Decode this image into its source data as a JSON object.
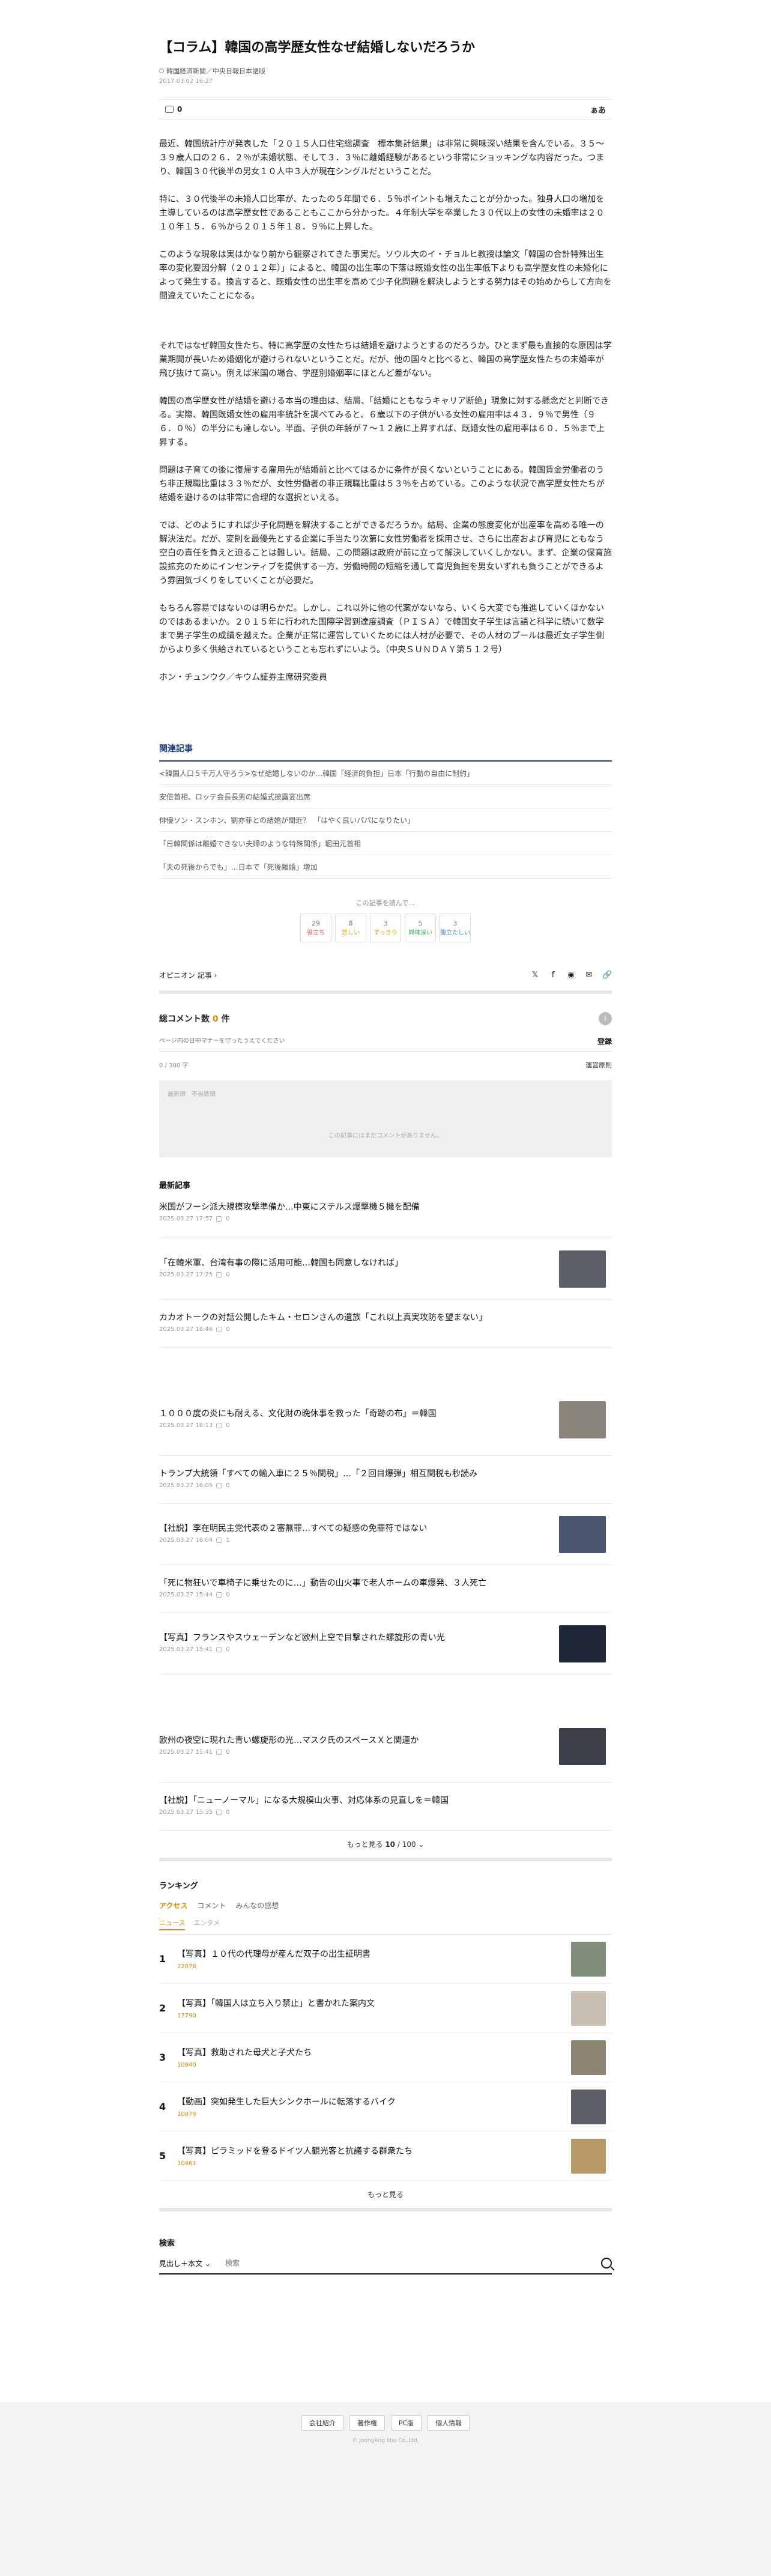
{
  "article": {
    "title": "【コラム】韓国の高学歴女性なぜ結婚しないだろうか",
    "source": "韓国経済新聞／中央日報日本語版",
    "date": "2017.03.02 16:27",
    "comment_count": "0",
    "font_label": "ぁあ",
    "paragraphs": [
      "最近、韓国統計庁が発表した「２０１５人口住宅総調査　標本集計結果」は非常に興味深い結果を含んでいる。３５～３９歳人口の２６．２％が未婚状態、そして３．３％に離婚経験があるという非常にショッキングな内容だった。つまり、韓国３０代後半の男女１０人中３人が現在シングルだということだ。",
      "特に、３０代後半の未婚人口比率が、たったの５年間で６．５％ポイントも増えたことが分かった。独身人口の増加を主導しているのは高学歴女性であることもここから分かった。４年制大学を卒業した３０代以上の女性の未婚率は２０１０年１５．６％から２０１５年１８．９％に上昇した。",
      "このような現象は実はかなり前から観察されてきた事実だ。ソウル大のイ・チョルヒ教授は論文「韓国の合計特殊出生率の変化要因分解（２０１２年）」によると、韓国の出生率の下落は既婚女性の出生率低下よりも高学歴女性の未婚化によって発生する。換言すると、既婚女性の出生率を高めて少子化問題を解決しようとする努力はその始めからして方向を間違えていたことになる。",
      "それではなぜ韓国女性たち、特に高学歴の女性たちは結婚を避けようとするのだろうか。ひとまず最も直接的な原因は学業期間が長いため婚姻化が避けられないということだ。だが、他の国々と比べると、韓国の高学歴女性たちの未婚率が飛び抜けて高い。例えば米国の場合、学歴別婚姻率にほとんど差がない。",
      "韓国の高学歴女性が結婚を避ける本当の理由は、結局、「結婚にともなうキャリア断絶」現象に対する懸念だと判断できる。実際、韓国既婚女性の雇用率統計を調べてみると、６歳以下の子供がいる女性の雇用率は４３．９％で男性（９６．０％）の半分にも達しない。半面、子供の年齢が７～１２歳に上昇すれば、既婚女性の雇用率は６０．５％まで上昇する。",
      "問題は子育ての後に復帰する雇用先が結婚前と比べてはるかに条件が良くないということにある。韓国賃金労働者のうち非正規職比重は３３％だが、女性労働者の非正規職比重は５３％を占めている。このような状況で高学歴女性たちが結婚を避けるのは非常に合理的な選択といえる。",
      "では、どのようにすれば少子化問題を解決することができるだろうか。結局、企業の態度変化が出産率を高める唯一の解決法だ。だが、変則を最優先とする企業に手当たり次第に女性労働者を採用させ、さらに出産および育児にともなう空白の責任を負えと迫ることは難しい。結局、この問題は政府が前に立って解決していくしかない。まず、企業の保育施設拡充のためにインセンティブを提供する一方、労働時間の短縮を通して育児負担を男女いずれも負うことができるよう雰囲気づくりをしていくことが必要だ。",
      "もちろん容易ではないのは明らかだ。しかし、これ以外に他の代案がないなら、いくら大変でも推進していくほかないのではあるまいか。２０１５年に行われた国際学習到達度調査（ＰＩＳＡ）で韓国女子学生は言語と科学に続いて数学まで男子学生の成績を越えた。企業が正常に運営していくためには人材が必要で、その人材のプールは最近女子学生側からより多く供給されているということも忘れずにいよう。（中央ＳＵＮＤＡＹ第５１２号）"
    ],
    "author": "ホン・チュンウク／キウム証券主席研究委員"
  },
  "related": {
    "heading": "関連記事",
    "items": [
      "<韓国人口５千万人守ろう>なぜ結婚しないのか…韓国「経済的負担」日本「行動の自由に制約」",
      "安倍首相、ロッテ会長長男の結婚式披露宴出席",
      "俳優ソン・スンホン、劉亦菲との結婚が間近？　「はやく良いパパになりたい」",
      "「日韓関係は離婚できない夫婦のような特殊関係」堀田元首相",
      "「夫の死後からでも」…日本で「死後離婚」増加"
    ],
    "reaction_title": "この記事を読んで…",
    "reactions": [
      {
        "count": "29",
        "label": "役立ち",
        "color": "#e85b5b"
      },
      {
        "count": "8",
        "label": "悲しい",
        "color": "#e0a400"
      },
      {
        "count": "3",
        "label": "すっきり",
        "color": "#e0a400"
      },
      {
        "count": "5",
        "label": "興味深い",
        "color": "#3ea860"
      },
      {
        "count": "3",
        "label": "腹立たしい",
        "color": "#3b8fd6"
      }
    ]
  },
  "opinion": {
    "label": "オピニオン 記事 ›",
    "share": {
      "x": "𝕏",
      "facebook": "f",
      "line": "◉",
      "mail": "✉",
      "link": "🔗"
    }
  },
  "comments": {
    "title_prefix": "総コメント数",
    "title_count": "0",
    "title_suffix": "件",
    "placeholder": "ページ内の日中マナーを守ったうえでください",
    "register": "登録",
    "counter": "0 / 300 字",
    "rules": "運営原則",
    "sort": "最新順　不当数順",
    "empty": "この記事にはまだコメントがありません。"
  },
  "latest": {
    "title": "最新記事",
    "items": [
      {
        "title": "米国がフーシ派大規模攻撃準備か…中東にステルス爆撃機５機を配備",
        "date": "2025.03.27 17:57",
        "count": "0",
        "thumb": ""
      },
      {
        "title": "「在韓米軍、台湾有事の際に活用可能…韓国も同意しなければ」",
        "date": "2025.03.27 17:25",
        "count": "0",
        "thumb": "#5a5e66"
      },
      {
        "title": "カカオトークの対話公開したキム・セロンさんの遺族「これ以上真実攻防を望まない」",
        "date": "2025.03.27 16:46",
        "count": "0",
        "thumb": ""
      },
      {
        "title": "１０００度の炎にも耐える、文化財の晩休事を救った「奇跡の布」＝韓国",
        "date": "2025.03.27 16:13",
        "count": "0",
        "thumb": "#8a857a"
      },
      {
        "title": "トランプ大統領「すべての輸入車に２５％関税」…「２回目爆弾」相互関税も秒読み",
        "date": "2025.03.27 16:05",
        "count": "0",
        "thumb": ""
      },
      {
        "title": "【社説】李在明民主党代表の２審無罪…すべての疑惑の免罪符ではない",
        "date": "2025.03.27 16:04",
        "count": "1",
        "thumb": "#4a5570"
      },
      {
        "title": "「死に物狂いで車椅子に乗せたのに…」動告の山火事で老人ホームの車爆発、３人死亡",
        "date": "2025.03.27 15:44",
        "count": "0",
        "thumb": ""
      },
      {
        "title": "【写真】フランスやスウェーデンなど欧州上空で目撃された螺旋形の青い光",
        "date": "2025.03.27 15:41",
        "count": "0",
        "thumb": "#1e2838"
      },
      {
        "title": "欧州の夜空に現れた青い螺旋形の光…マスク氏のスペースＸと関連か",
        "date": "2025.03.27 15:41",
        "count": "0",
        "thumb": "#3a3f4a"
      },
      {
        "title": "【社説】「ニューノーマル」になる大規模山火事、対応体系の見直しを＝韓国",
        "date": "2025.03.27 15:35",
        "count": "0",
        "thumb": ""
      }
    ],
    "more_prefix": "もっと見る ",
    "more_count": "10",
    "more_suffix": " / 100 ⌄"
  },
  "ranking": {
    "title": "ランキング",
    "tabs": [
      "アクセス",
      "コメント",
      "みんなの感想"
    ],
    "sub_tabs": [
      "ニュース",
      "エンタメ"
    ],
    "items": [
      {
        "rank": "1",
        "title": "【写真】１０代の代理母が産んだ双子の出生証明書",
        "views": "22078",
        "thumb": "#7f8f7c"
      },
      {
        "rank": "2",
        "title": "【写真】「韓国人は立ち入り禁止」と書かれた案内文",
        "views": "17790",
        "thumb": "#c9bfb2"
      },
      {
        "rank": "3",
        "title": "【写真】救助された母犬と子犬たち",
        "views": "10940",
        "thumb": "#8a8470"
      },
      {
        "rank": "4",
        "title": "【動画】突如発生した巨大シンクホールに転落するバイク",
        "views": "10879",
        "thumb": "#5d6068"
      },
      {
        "rank": "5",
        "title": "【写真】ピラミッドを登るドイツ人観光客と抗議する群衆たち",
        "views": "10461",
        "thumb": "#b89a6a"
      }
    ],
    "more": "もっと見る"
  },
  "search": {
    "title": "検索",
    "select": "見出し＋本文 ⌄",
    "placeholder": "検索"
  },
  "footer": {
    "links": [
      "会社紹介",
      "著作権",
      "PC版",
      "個人情報"
    ],
    "copyright": "© JoongAng Ilbo Co.,Ltd."
  }
}
